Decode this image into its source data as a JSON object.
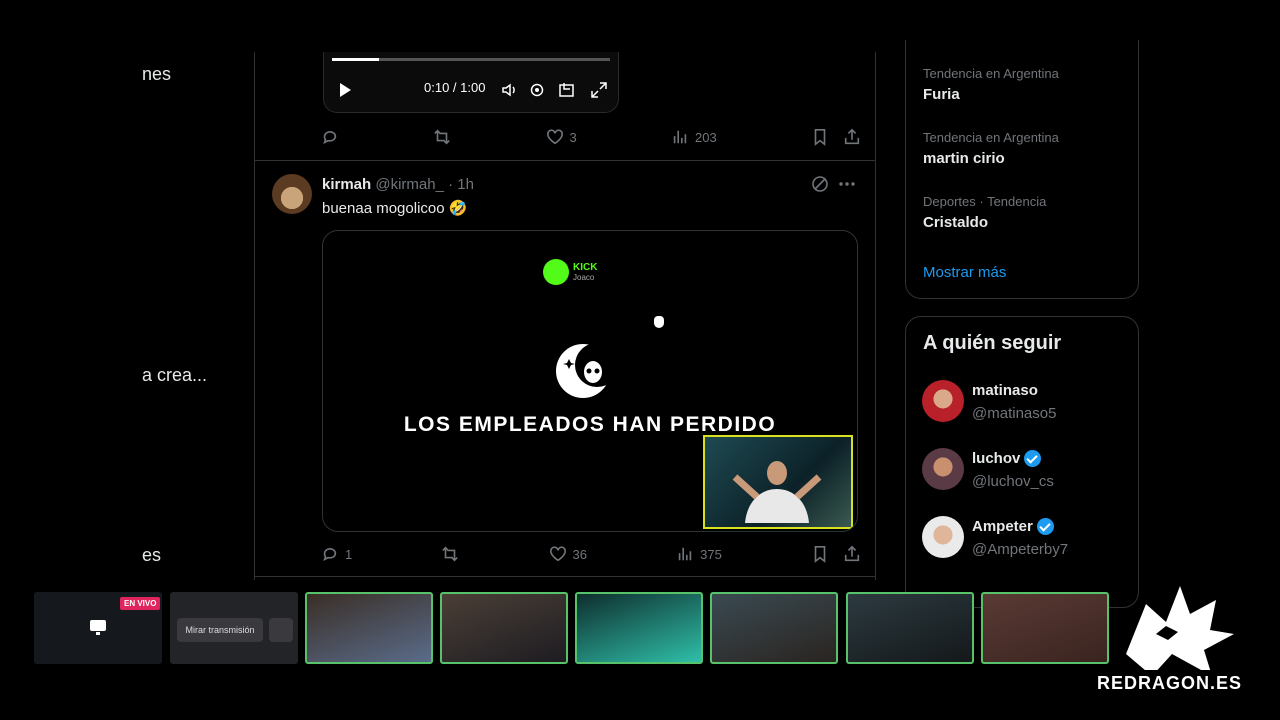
{
  "left_nav": {
    "frag1": "nes",
    "frag2": "a crea...",
    "frag3": "es"
  },
  "video": {
    "time": "0:10 / 1:00",
    "progress": 0.17
  },
  "tweet1_actions": {
    "likes": "3",
    "views": "203"
  },
  "tweet2": {
    "name": "kirmah",
    "handle": "@kirmah_",
    "time": "· 1h",
    "text": "buenaa mogolicoo 🤣",
    "media": {
      "kick_brand": "KICK",
      "kick_user": "Joaco",
      "banner": "LOS EMPLEADOS HAN PERDIDO"
    },
    "replies": "1",
    "likes": "36",
    "views": "375"
  },
  "trends": [
    {
      "context": "Tendencia en Argentina",
      "name": "Furia"
    },
    {
      "context": "Tendencia en Argentina",
      "name": "martin cirio"
    },
    {
      "context": "Deportes · Tendencia",
      "name": "Cristaldo"
    }
  ],
  "show_more": "Mostrar más",
  "who_to_follow": {
    "title": "A quién seguir",
    "accounts": [
      {
        "name": "matinaso",
        "handle": "@matinaso5",
        "verified": false
      },
      {
        "name": "luchov",
        "handle": "@luchov_cs",
        "verified": true
      },
      {
        "name": "Ampeter",
        "handle": "@Ampeterby7",
        "verified": true
      }
    ]
  },
  "stream_bar": {
    "live_badge": "EN VIVO",
    "watch_label": "Mirar transmisión"
  },
  "brand": "REDRAGON.ES",
  "colors": {
    "accent_blue": "#1d9bf0",
    "kick_green": "#53fc18",
    "live_red": "#e0245e",
    "cam_border": "#58c26a"
  }
}
